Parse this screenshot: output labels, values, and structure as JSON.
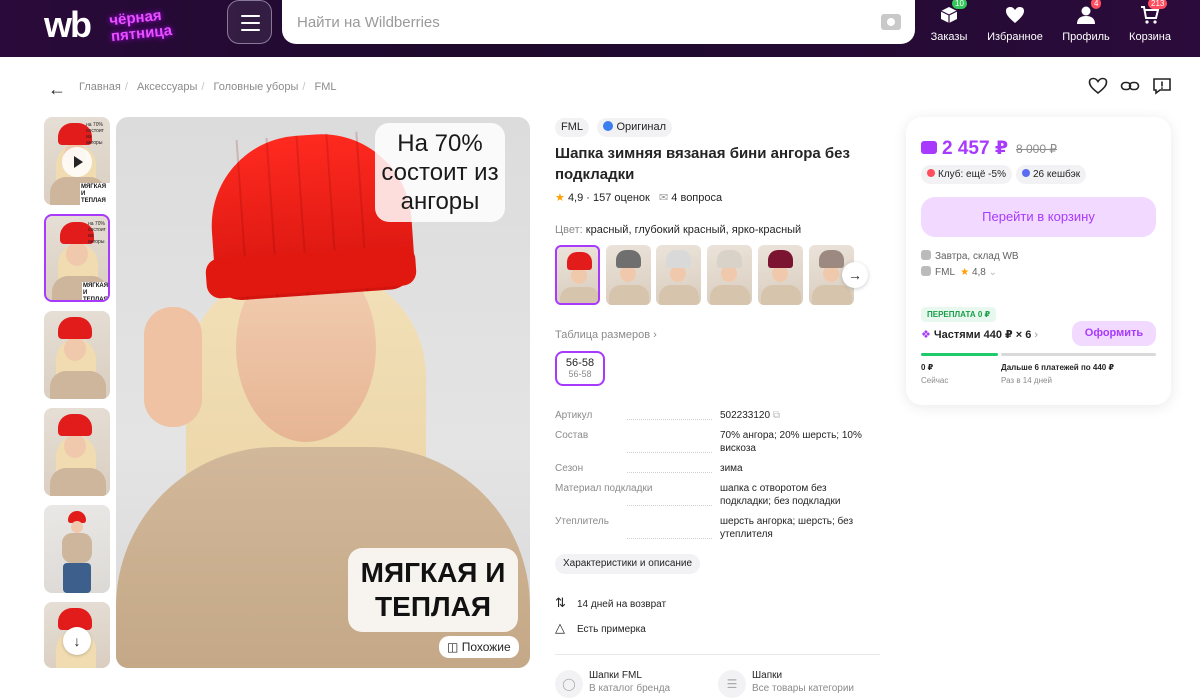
{
  "header": {
    "logo": "wb",
    "promo_line1": "чёрная",
    "promo_line2": "пятница",
    "search_placeholder": "Найти на Wildberries",
    "nav": [
      {
        "label": "Заказы",
        "badge": "10",
        "icon": "box-icon"
      },
      {
        "label": "Избранное",
        "badge": "",
        "icon": "heart-icon"
      },
      {
        "label": "Профиль",
        "badge": "4",
        "icon": "user-icon"
      },
      {
        "label": "Корзина",
        "badge": "213",
        "icon": "cart-icon"
      }
    ]
  },
  "breadcrumbs": [
    "Главная",
    "Аксессуары",
    "Головные уборы",
    "FML"
  ],
  "gallery": {
    "overlay_top": "На 70% состоит из ангоры",
    "overlay_bottom": "МЯГКАЯ И ТЕПЛАЯ",
    "similar_label": "Похожие",
    "thumb_text_top": "на 70% состоит из ангоры",
    "thumb_text_bottom": "МЯГКАЯ И ТЕПЛАЯ"
  },
  "product": {
    "brand_tag": "FML",
    "original_tag": "Оригинал",
    "title": "Шапка зимняя вязаная бини ангора без подкладки",
    "rating": "4,9",
    "reviews": "157 оценок",
    "questions": "4 вопроса",
    "color_label": "Цвет:",
    "color_value": "красный, глубокий красный, ярко-красный",
    "swatch_colors": [
      "#e21b1b",
      "#6f6f6f",
      "#d9d9d9",
      "#d9d2c9",
      "#7b1430",
      "#9c8a80"
    ],
    "size_table_label": "Таблица размеров",
    "size": "56-58",
    "size_ru": "56-58",
    "specs": [
      {
        "k": "Артикул",
        "v": "502233120"
      },
      {
        "k": "Состав",
        "v": "70% ангора; 20% шерсть; 10% вискоза"
      },
      {
        "k": "Сезон",
        "v": "зима"
      },
      {
        "k": "Материал подкладки",
        "v": "шапка с отворотом без подкладки; без подкладки"
      },
      {
        "k": "Утеплитель",
        "v": "шерсть ангорка; шерсть; без утеплителя"
      }
    ],
    "char_button": "Характеристики и описание",
    "return_text": "14 дней на возврат",
    "fitting_text": "Есть примерка",
    "categories": [
      {
        "title": "Шапки FML",
        "sub": "В каталог бренда"
      },
      {
        "title": "Шапки",
        "sub": "Все товары категории"
      }
    ]
  },
  "buy": {
    "price": "2 457 ₽",
    "old_price": "8 000 ₽",
    "club": "Клуб: ещё -5%",
    "cashback": "26 кешбэк",
    "cart_button": "Перейти в корзину",
    "delivery": "Завтра, склад WB",
    "seller": "FML",
    "seller_rating": "4,8",
    "overpay": "ПЕРЕПЛАТА 0 ₽",
    "parts": "Частями 440 ₽ × 6",
    "order_button": "Оформить",
    "now_amount": "0 ₽",
    "now_label": "Сейчас",
    "next_amount": "Дальше 6 платежей по 440 ₽",
    "next_label": "Раз в 14 дней"
  },
  "colors": {
    "accent": "#a73afd",
    "header_bg": "#1d0a2c",
    "star": "#ff9f00",
    "green": "#1a9e4a"
  }
}
